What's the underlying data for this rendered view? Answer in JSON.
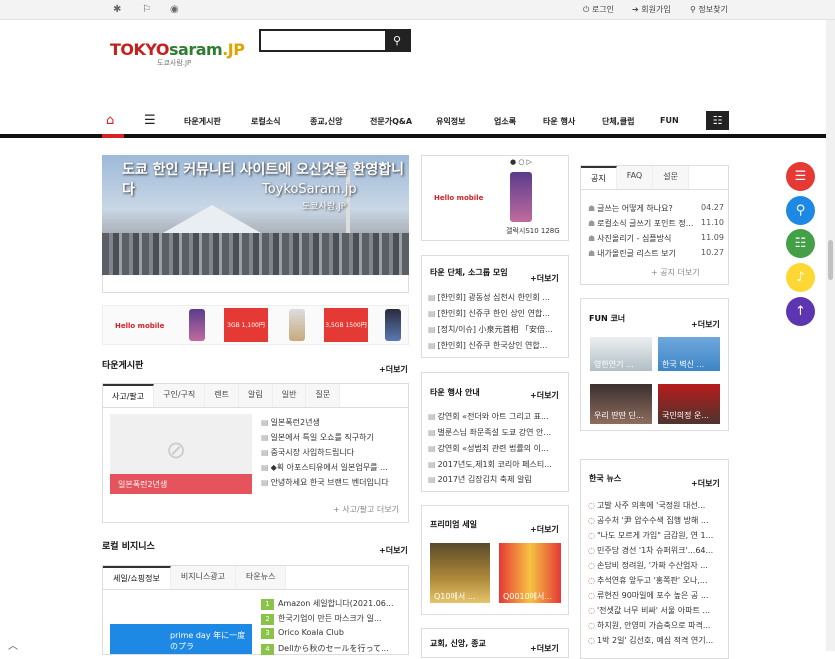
{
  "topbar": {
    "icons": [
      "bug-icon",
      "bookmark-icon",
      "rss-icon"
    ],
    "login": "로그인",
    "signup": "회원가입",
    "find_info": "정보찾기"
  },
  "logo": {
    "tokyo": "TOKYO",
    "saram": "saram",
    "jp": ".JP",
    "sub": "도쿄사람.JP"
  },
  "search": {
    "placeholder": "",
    "button_icon": "search-icon"
  },
  "nav": {
    "items": [
      "타운게시판",
      "로컬소식",
      "종교,신앙",
      "전문가Q&A",
      "유익정보",
      "업소록",
      "타운 행사",
      "단체,클럽",
      "FUN"
    ]
  },
  "banner": {
    "line1": "도쿄 한인 커뮤니티 사이트에 오신것을 환영합니다",
    "line2": "ToykoSaram.jp",
    "line3": "도쿄사람.JP"
  },
  "ads": {
    "hello": "Hello mobile",
    "galaxy": "갤럭시S10 128G",
    "tiles": [
      "3GB 1,100円",
      "3,5GB 1500円"
    ]
  },
  "town_board": {
    "title": "타운게시판",
    "more": "+더보기",
    "tabs": [
      "사고/팔고",
      "구인/구직",
      "렌트",
      "알림",
      "일반",
      "질문"
    ],
    "thumb_caption": "일본폭런2년생",
    "items": [
      "일본폭런2년생",
      "일본에서 특일 오쇼를 직구하기",
      "중국시장 사입하드립니다",
      "◆획 아포스티유에서 일본업무를 ...",
      "안녕하세요 한국 브랜드 벤더입니다"
    ],
    "footer": "+ 사고/팔고 더보기"
  },
  "local_biz": {
    "title": "로컬 비지니스",
    "more": "+더보기",
    "tabs": [
      "세일/쇼핑정보",
      "비지니스광고",
      "타운뉴스"
    ],
    "banner_text": "prime day 年に一度のプラ",
    "items": [
      "Amazon 세일합니다(2021.06...",
      "한국기업이 만든 마스크가 일...",
      "Orico Koala Club",
      "Dellから秋のセールを行って..."
    ],
    "nums": [
      "1",
      "2",
      "3",
      "4"
    ]
  },
  "groups": {
    "title": "타운 단체, 소그룹 모임",
    "more": "+더보기",
    "items": [
      "[한인회] 광동성 심천시 한인회 ...",
      "[한인회] 신쥬쿠 한인 상인 연합...",
      "[정치/이슈] 小泉元首相 「安倍...",
      "[한인회] 신쥬쿠 한국상인 연합..."
    ]
  },
  "events": {
    "title": "타운 행사 안내",
    "more": "+더보기",
    "items": [
      "강연회 «전더와 아트 그리고 표...",
      "벌룬스님 좌문족설 도쿄 강연 안...",
      "강연회 «성범죄 관련 법률의 이...",
      "2017년도,제1회 코리아 페스티...",
      "2017년 김장김치 축제 알림"
    ]
  },
  "premium_sale": {
    "title": "프리미엄 세일",
    "more": "+더보기",
    "captions": [
      "Q10에서 ...",
      "Q0010에서..."
    ]
  },
  "religion": {
    "title": "교회, 신앙, 종교",
    "more": "+더보기"
  },
  "notice": {
    "tabs": [
      "공지",
      "FAQ",
      "설문"
    ],
    "items": [
      {
        "text": "글쓰는 어떻게 하나요?",
        "date": "04.27"
      },
      {
        "text": "로컬소식 글쓰기 포인트 정...",
        "date": "11.10"
      },
      {
        "text": "사진올리기 - 심플방식",
        "date": "11.09"
      },
      {
        "text": "내가올린글 리스트 보기",
        "date": "10.27"
      }
    ],
    "more": "+ 공지 더보기"
  },
  "fun": {
    "title": "FUN 코너",
    "more": "+더보기",
    "captions": [
      "영한연기 ...",
      "한국 벽신 ...",
      "우리 딴딴 딘...",
      "국민의정 운..."
    ]
  },
  "news": {
    "title": "한국 뉴스",
    "more": "+더보기",
    "items": [
      "고발 사주 의혹에 '국정원 대선...",
      "공수처 '尹 압수수색 집행 방해 ...",
      "\"나도 모르게 가입\" 금감원, 연 1...",
      "민주당 경선 '1차 슈퍼위크'...64...",
      "손담비 정려원, '가짜 수산업자 ...",
      "추석연휴 앞두고 '홍쪽판' 오나,...",
      "류현진 90마일에 포수 높은 공 ...",
      "'전셋값 너무 비싸' 서울 아파트 ...",
      "하지원, 안영미 가슴축으로 파격...",
      "1박 2일' 김선호, 예심 적격 연기..."
    ]
  },
  "fabs": [
    {
      "icon": "list-icon",
      "color": "#e53935"
    },
    {
      "icon": "search-icon",
      "color": "#1e88e5"
    },
    {
      "icon": "list-alt-icon",
      "color": "#43a047"
    },
    {
      "icon": "bell-icon",
      "color": "#fdd835"
    },
    {
      "icon": "arrow-up-icon",
      "color": "#5e35b1"
    }
  ]
}
